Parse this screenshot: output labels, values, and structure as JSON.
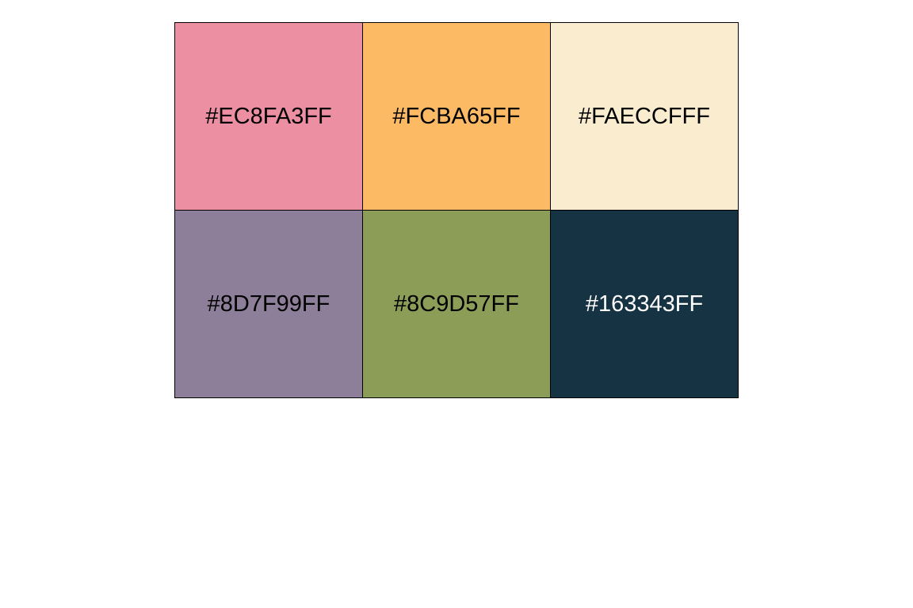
{
  "swatches": [
    {
      "label": "#EC8FA3FF",
      "color": "#EC8FA3",
      "text_color": "#000000"
    },
    {
      "label": "#FCBA65FF",
      "color": "#FCBA65",
      "text_color": "#000000"
    },
    {
      "label": "#FAECCFFF",
      "color": "#FAECCF",
      "text_color": "#000000"
    },
    {
      "label": "#8D7F99FF",
      "color": "#8D7F99",
      "text_color": "#000000"
    },
    {
      "label": "#8C9D57FF",
      "color": "#8C9D57",
      "text_color": "#000000"
    },
    {
      "label": "#163343FF",
      "color": "#163343",
      "text_color": "#FFFFFF"
    }
  ]
}
